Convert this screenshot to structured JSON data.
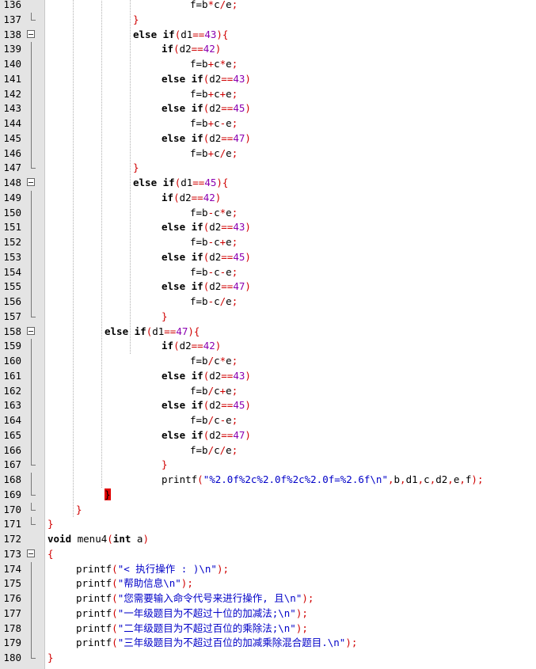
{
  "editor": {
    "lines": [
      {
        "n": "136",
        "indent": 5,
        "tokens": [
          [
            "t",
            "f=b"
          ],
          [
            "p",
            "*"
          ],
          [
            "t",
            "c"
          ],
          [
            "p",
            "/"
          ],
          [
            "t",
            "e"
          ],
          [
            "p",
            ";"
          ]
        ]
      },
      {
        "n": "137",
        "indent": 3,
        "fold": "end",
        "tokens": [
          [
            "br",
            "}"
          ]
        ]
      },
      {
        "n": "138",
        "indent": 3,
        "fold": "open",
        "tokens": [
          [
            "k",
            "else if"
          ],
          [
            "p",
            "("
          ],
          [
            "t",
            "d1"
          ],
          [
            "p",
            "=="
          ],
          [
            "n",
            "43"
          ],
          [
            "p",
            "){"
          ]
        ]
      },
      {
        "n": "139",
        "indent": 4,
        "fold": "line",
        "tokens": [
          [
            "k",
            "if"
          ],
          [
            "p",
            "("
          ],
          [
            "t",
            "d2"
          ],
          [
            "p",
            "=="
          ],
          [
            "n",
            "42"
          ],
          [
            "p",
            ")"
          ]
        ]
      },
      {
        "n": "140",
        "indent": 5,
        "fold": "line",
        "tokens": [
          [
            "t",
            "f=b"
          ],
          [
            "p",
            "+"
          ],
          [
            "t",
            "c"
          ],
          [
            "p",
            "*"
          ],
          [
            "t",
            "e"
          ],
          [
            "p",
            ";"
          ]
        ]
      },
      {
        "n": "141",
        "indent": 4,
        "fold": "line",
        "tokens": [
          [
            "k",
            "else if"
          ],
          [
            "p",
            "("
          ],
          [
            "t",
            "d2"
          ],
          [
            "p",
            "=="
          ],
          [
            "n",
            "43"
          ],
          [
            "p",
            ")"
          ]
        ]
      },
      {
        "n": "142",
        "indent": 5,
        "fold": "line",
        "tokens": [
          [
            "t",
            "f=b"
          ],
          [
            "p",
            "+"
          ],
          [
            "t",
            "c"
          ],
          [
            "p",
            "+"
          ],
          [
            "t",
            "e"
          ],
          [
            "p",
            ";"
          ]
        ]
      },
      {
        "n": "143",
        "indent": 4,
        "fold": "line",
        "tokens": [
          [
            "k",
            "else if"
          ],
          [
            "p",
            "("
          ],
          [
            "t",
            "d2"
          ],
          [
            "p",
            "=="
          ],
          [
            "n",
            "45"
          ],
          [
            "p",
            ")"
          ]
        ]
      },
      {
        "n": "144",
        "indent": 5,
        "fold": "line",
        "tokens": [
          [
            "t",
            "f=b"
          ],
          [
            "p",
            "+"
          ],
          [
            "t",
            "c"
          ],
          [
            "p",
            "-"
          ],
          [
            "t",
            "e"
          ],
          [
            "p",
            ";"
          ]
        ]
      },
      {
        "n": "145",
        "indent": 4,
        "fold": "line",
        "tokens": [
          [
            "k",
            "else if"
          ],
          [
            "p",
            "("
          ],
          [
            "t",
            "d2"
          ],
          [
            "p",
            "=="
          ],
          [
            "n",
            "47"
          ],
          [
            "p",
            ")"
          ]
        ]
      },
      {
        "n": "146",
        "indent": 5,
        "fold": "line",
        "tokens": [
          [
            "t",
            "f=b"
          ],
          [
            "p",
            "+"
          ],
          [
            "t",
            "c"
          ],
          [
            "p",
            "/"
          ],
          [
            "t",
            "e"
          ],
          [
            "p",
            ";"
          ]
        ]
      },
      {
        "n": "147",
        "indent": 3,
        "fold": "end",
        "tokens": [
          [
            "br",
            "}"
          ]
        ]
      },
      {
        "n": "148",
        "indent": 3,
        "fold": "open",
        "tokens": [
          [
            "k",
            "else if"
          ],
          [
            "p",
            "("
          ],
          [
            "t",
            "d1"
          ],
          [
            "p",
            "=="
          ],
          [
            "n",
            "45"
          ],
          [
            "p",
            "){"
          ]
        ]
      },
      {
        "n": "149",
        "indent": 4,
        "fold": "line",
        "tokens": [
          [
            "k",
            "if"
          ],
          [
            "p",
            "("
          ],
          [
            "t",
            "d2"
          ],
          [
            "p",
            "=="
          ],
          [
            "n",
            "42"
          ],
          [
            "p",
            ")"
          ]
        ]
      },
      {
        "n": "150",
        "indent": 5,
        "fold": "line",
        "tokens": [
          [
            "t",
            "f=b"
          ],
          [
            "p",
            "-"
          ],
          [
            "t",
            "c"
          ],
          [
            "p",
            "*"
          ],
          [
            "t",
            "e"
          ],
          [
            "p",
            ";"
          ]
        ]
      },
      {
        "n": "151",
        "indent": 4,
        "fold": "line",
        "tokens": [
          [
            "k",
            "else if"
          ],
          [
            "p",
            "("
          ],
          [
            "t",
            "d2"
          ],
          [
            "p",
            "=="
          ],
          [
            "n",
            "43"
          ],
          [
            "p",
            ")"
          ]
        ]
      },
      {
        "n": "152",
        "indent": 5,
        "fold": "line",
        "tokens": [
          [
            "t",
            "f=b"
          ],
          [
            "p",
            "-"
          ],
          [
            "t",
            "c"
          ],
          [
            "p",
            "+"
          ],
          [
            "t",
            "e"
          ],
          [
            "p",
            ";"
          ]
        ]
      },
      {
        "n": "153",
        "indent": 4,
        "fold": "line",
        "tokens": [
          [
            "k",
            "else if"
          ],
          [
            "p",
            "("
          ],
          [
            "t",
            "d2"
          ],
          [
            "p",
            "=="
          ],
          [
            "n",
            "45"
          ],
          [
            "p",
            ")"
          ]
        ]
      },
      {
        "n": "154",
        "indent": 5,
        "fold": "line",
        "tokens": [
          [
            "t",
            "f=b"
          ],
          [
            "p",
            "-"
          ],
          [
            "t",
            "c"
          ],
          [
            "p",
            "-"
          ],
          [
            "t",
            "e"
          ],
          [
            "p",
            ";"
          ]
        ]
      },
      {
        "n": "155",
        "indent": 4,
        "fold": "line",
        "tokens": [
          [
            "k",
            "else if"
          ],
          [
            "p",
            "("
          ],
          [
            "t",
            "d2"
          ],
          [
            "p",
            "=="
          ],
          [
            "n",
            "47"
          ],
          [
            "p",
            ")"
          ]
        ]
      },
      {
        "n": "156",
        "indent": 5,
        "fold": "line",
        "tokens": [
          [
            "t",
            "f=b"
          ],
          [
            "p",
            "-"
          ],
          [
            "t",
            "c"
          ],
          [
            "p",
            "/"
          ],
          [
            "t",
            "e"
          ],
          [
            "p",
            ";"
          ]
        ]
      },
      {
        "n": "157",
        "indent": 4,
        "fold": "end",
        "tokens": [
          [
            "br",
            "}"
          ]
        ]
      },
      {
        "n": "158",
        "indent": 2,
        "fold": "open",
        "tokens": [
          [
            "k",
            "else if"
          ],
          [
            "p",
            "("
          ],
          [
            "t",
            "d1"
          ],
          [
            "p",
            "=="
          ],
          [
            "n",
            "47"
          ],
          [
            "p",
            "){"
          ]
        ]
      },
      {
        "n": "159",
        "indent": 4,
        "fold": "line",
        "tokens": [
          [
            "k",
            "if"
          ],
          [
            "p",
            "("
          ],
          [
            "t",
            "d2"
          ],
          [
            "p",
            "=="
          ],
          [
            "n",
            "42"
          ],
          [
            "p",
            ")"
          ]
        ]
      },
      {
        "n": "160",
        "indent": 5,
        "fold": "line",
        "tokens": [
          [
            "t",
            "f=b"
          ],
          [
            "p",
            "/"
          ],
          [
            "t",
            "c"
          ],
          [
            "p",
            "*"
          ],
          [
            "t",
            "e"
          ],
          [
            "p",
            ";"
          ]
        ]
      },
      {
        "n": "161",
        "indent": 4,
        "fold": "line",
        "tokens": [
          [
            "k",
            "else if"
          ],
          [
            "p",
            "("
          ],
          [
            "t",
            "d2"
          ],
          [
            "p",
            "=="
          ],
          [
            "n",
            "43"
          ],
          [
            "p",
            ")"
          ]
        ]
      },
      {
        "n": "162",
        "indent": 5,
        "fold": "line",
        "tokens": [
          [
            "t",
            "f=b"
          ],
          [
            "p",
            "/"
          ],
          [
            "t",
            "c"
          ],
          [
            "p",
            "+"
          ],
          [
            "t",
            "e"
          ],
          [
            "p",
            ";"
          ]
        ]
      },
      {
        "n": "163",
        "indent": 4,
        "fold": "line",
        "tokens": [
          [
            "k",
            "else if"
          ],
          [
            "p",
            "("
          ],
          [
            "t",
            "d2"
          ],
          [
            "p",
            "=="
          ],
          [
            "n",
            "45"
          ],
          [
            "p",
            ")"
          ]
        ]
      },
      {
        "n": "164",
        "indent": 5,
        "fold": "line",
        "tokens": [
          [
            "t",
            "f=b"
          ],
          [
            "p",
            "/"
          ],
          [
            "t",
            "c"
          ],
          [
            "p",
            "-"
          ],
          [
            "t",
            "e"
          ],
          [
            "p",
            ";"
          ]
        ]
      },
      {
        "n": "165",
        "indent": 4,
        "fold": "line",
        "tokens": [
          [
            "k",
            "else if"
          ],
          [
            "p",
            "("
          ],
          [
            "t",
            "d2"
          ],
          [
            "p",
            "=="
          ],
          [
            "n",
            "47"
          ],
          [
            "p",
            ")"
          ]
        ]
      },
      {
        "n": "166",
        "indent": 5,
        "fold": "line",
        "tokens": [
          [
            "t",
            "f=b"
          ],
          [
            "p",
            "/"
          ],
          [
            "t",
            "c"
          ],
          [
            "p",
            "/"
          ],
          [
            "t",
            "e"
          ],
          [
            "p",
            ";"
          ]
        ]
      },
      {
        "n": "167",
        "indent": 4,
        "fold": "end",
        "tokens": [
          [
            "br",
            "}"
          ]
        ]
      },
      {
        "n": "168",
        "indent": 4,
        "fold": "line",
        "tokens": [
          [
            "t",
            "printf"
          ],
          [
            "p",
            "("
          ],
          [
            "s",
            "\"%2.0f%2c%2.0f%2c%2.0f=%2.6f\\n\""
          ],
          [
            "p",
            ","
          ],
          [
            "t",
            "b"
          ],
          [
            "p",
            ","
          ],
          [
            "t",
            "d1"
          ],
          [
            "p",
            ","
          ],
          [
            "t",
            "c"
          ],
          [
            "p",
            ","
          ],
          [
            "t",
            "d2"
          ],
          [
            "p",
            ","
          ],
          [
            "t",
            "e"
          ],
          [
            "p",
            ","
          ],
          [
            "t",
            "f"
          ],
          [
            "p",
            ");"
          ]
        ]
      },
      {
        "n": "169",
        "indent": 2,
        "fold": "end",
        "tokens": [
          [
            "cur",
            "}"
          ]
        ]
      },
      {
        "n": "170",
        "indent": 1,
        "fold": "end",
        "tokens": [
          [
            "br",
            "}"
          ]
        ]
      },
      {
        "n": "171",
        "indent": 0,
        "fold": "end",
        "tokens": [
          [
            "br",
            "}"
          ]
        ]
      },
      {
        "n": "172",
        "indent": 0,
        "tokens": [
          [
            "k",
            "void"
          ],
          [
            "t",
            " menu4"
          ],
          [
            "p",
            "("
          ],
          [
            "k",
            "int"
          ],
          [
            "t",
            " a"
          ],
          [
            "p",
            ")"
          ]
        ]
      },
      {
        "n": "173",
        "indent": 0,
        "fold": "open",
        "tokens": [
          [
            "br",
            "{"
          ]
        ]
      },
      {
        "n": "174",
        "indent": 1,
        "fold": "line",
        "tokens": [
          [
            "t",
            "printf"
          ],
          [
            "p",
            "("
          ],
          [
            "s",
            "\"< 执行操作 : )\\n\""
          ],
          [
            "p",
            ");"
          ]
        ]
      },
      {
        "n": "175",
        "indent": 1,
        "fold": "line",
        "tokens": [
          [
            "t",
            "printf"
          ],
          [
            "p",
            "("
          ],
          [
            "s",
            "\"帮助信息\\n\""
          ],
          [
            "p",
            ");"
          ]
        ]
      },
      {
        "n": "176",
        "indent": 1,
        "fold": "line",
        "tokens": [
          [
            "t",
            "printf"
          ],
          [
            "p",
            "("
          ],
          [
            "s",
            "\"您需要输入命令代号来进行操作, 且\\n\""
          ],
          [
            "p",
            ");"
          ]
        ]
      },
      {
        "n": "177",
        "indent": 1,
        "fold": "line",
        "tokens": [
          [
            "t",
            "printf"
          ],
          [
            "p",
            "("
          ],
          [
            "s",
            "\"一年级题目为不超过十位的加减法;\\n\""
          ],
          [
            "p",
            ");"
          ]
        ]
      },
      {
        "n": "178",
        "indent": 1,
        "fold": "line",
        "tokens": [
          [
            "t",
            "printf"
          ],
          [
            "p",
            "("
          ],
          [
            "s",
            "\"二年级题目为不超过百位的乘除法;\\n\""
          ],
          [
            "p",
            ");"
          ]
        ]
      },
      {
        "n": "179",
        "indent": 1,
        "fold": "line",
        "tokens": [
          [
            "t",
            "printf"
          ],
          [
            "p",
            "("
          ],
          [
            "s",
            "\"三年级题目为不超过百位的加减乘除混合题目.\\n\""
          ],
          [
            "p",
            ");"
          ]
        ]
      },
      {
        "n": "180",
        "indent": 0,
        "fold": "end",
        "tokens": [
          [
            "br",
            "}"
          ]
        ]
      }
    ]
  },
  "colors": {
    "keyword": "#000000",
    "number": "#8b00b0",
    "operator": "#d00000",
    "string": "#0000c8",
    "gutter": "#e4e4e4"
  }
}
